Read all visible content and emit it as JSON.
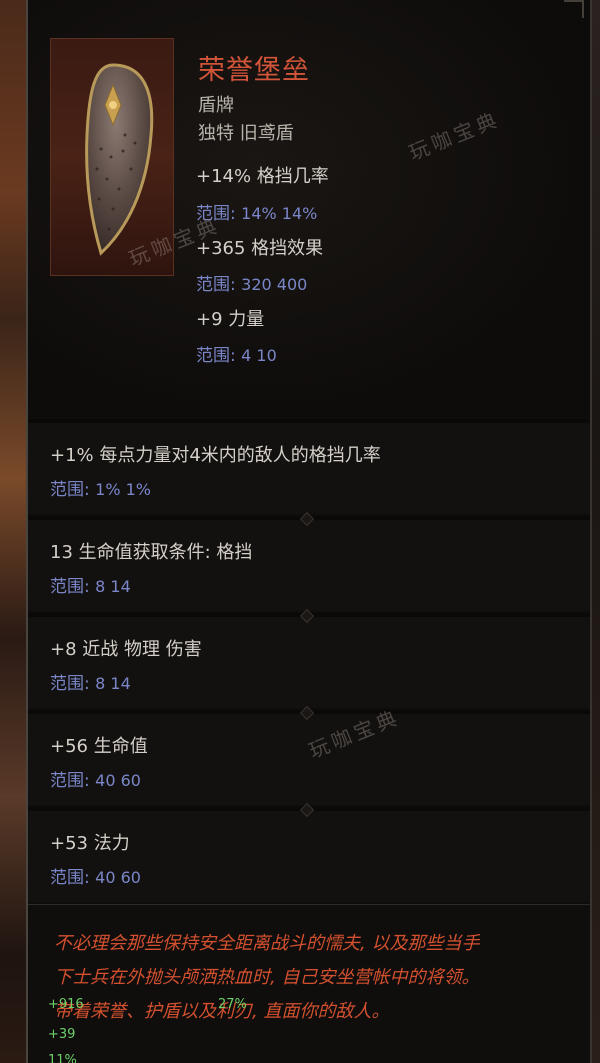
{
  "item": {
    "name": "荣誉堡垒",
    "type": "盾牌",
    "rarity_base": "独特 旧鸢盾",
    "implicits": [
      {
        "stat": "+14% 格挡几率",
        "range_label": "范围:",
        "range_values": "14%  14%"
      },
      {
        "stat": "+365 格挡效果",
        "range_label": "范围:",
        "range_values": "320  400"
      },
      {
        "stat": "+9 力量",
        "range_label": "范围:",
        "range_values": "4  10"
      }
    ]
  },
  "affixes": [
    {
      "stat": "+1% 每点力量对4米内的敌人的格挡几率",
      "range_label": "范围:",
      "range_values": "1%  1%"
    },
    {
      "stat": "13 生命值获取条件:  格挡",
      "range_label": "范围:",
      "range_values": "8  14"
    },
    {
      "stat": "+8 近战 物理 伤害",
      "range_label": "范围:",
      "range_values": "8  14"
    },
    {
      "stat": "+56 生命值",
      "range_label": "范围:",
      "range_values": "40  60"
    },
    {
      "stat": "+53 法力",
      "range_label": "范围:",
      "range_values": "40  60"
    }
  ],
  "lore": [
    "不必理会那些保持安全距离战斗的懦夫, 以及那些当手",
    "下士兵在外抛头颅洒热血时, 自己安坐营帐中的将领。",
    "带着荣誉、护盾以及利刃, 直面你的敌人。"
  ],
  "overlay_numbers": [
    "+916",
    "27%",
    "+39",
    "11%"
  ],
  "watermarks": [
    "玩咖宝典",
    "玩咖宝典",
    "玩咖宝典"
  ],
  "colors": {
    "unique_name": "#d2553a",
    "range_blue": "#7a86c8",
    "lore_orange": "#d2502e",
    "stat_text": "#d4cfc8"
  }
}
